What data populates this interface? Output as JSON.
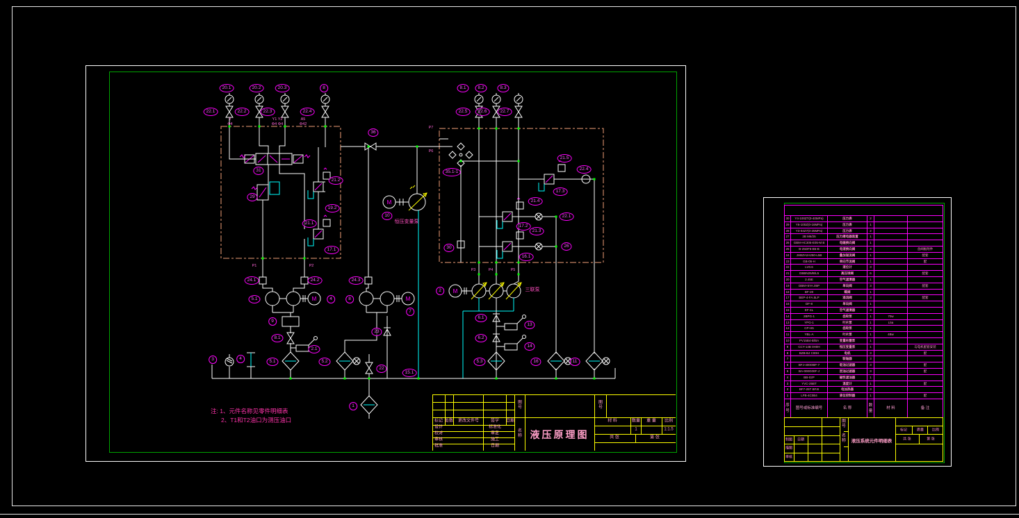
{
  "sheet1": {
    "notes": {
      "line1": "注: 1、元件名称见零件明细表",
      "line2": "2、T1和T2油口为测压油口"
    },
    "texts": {
      "motor_letter": "M",
      "variable_pump_label": "恒压变量泵",
      "triple_pump_label": "三联泵"
    },
    "labels": [
      "20.1",
      "20.2",
      "20.3",
      "8",
      "22.1",
      "22.2",
      "22.3",
      "22.4",
      "36",
      "8.1",
      "8.2",
      "8.3",
      "22.5",
      "22.6",
      "22.7",
      "31",
      "29",
      "21.2",
      "19.2",
      "21.1",
      "17.1",
      "35.1-1",
      "21.5",
      "22.4",
      "17.3",
      "21.4",
      "17.2",
      "22.1",
      "21.3",
      "16.1",
      "26",
      "30",
      "10",
      "24.1",
      "24.2",
      "24.3",
      "5.1",
      "4",
      "8",
      "7",
      "2",
      "9",
      "8.1",
      "3",
      "4",
      "5.1",
      "2.1",
      "5.2",
      "23",
      "1",
      "22",
      "15.1",
      "6.1",
      "6.2",
      "13",
      "14",
      "5.3",
      "16",
      "11"
    ],
    "ports": [
      "P1",
      "P2",
      "P3",
      "P4",
      "P5",
      "P6",
      "P7",
      "Y",
      "Φ4",
      "Y1 Y2",
      "Φ4 Φ4",
      "A5",
      "Φ42"
    ],
    "tb": {
      "rev_header": [
        "标记",
        "处数",
        "更改文件号",
        "签字",
        "日期"
      ],
      "sign_rows": [
        {
          "l": "设计",
          "r": "标准化"
        },
        {
          "l": "校对",
          "r": "审定"
        },
        {
          "l": "审核",
          "r": "施工"
        },
        {
          "l": "批准",
          "r": "日期"
        }
      ],
      "drawing_no_label": "图号",
      "drawing_no_label2": "图号",
      "name_label": "名称",
      "title": "液压原理图",
      "material_label": "材 料",
      "qty_label": "数量",
      "weight_label": "重 量",
      "scale_label": "比例",
      "qty_value": "1",
      "scale_value": "1:1.5",
      "sheets_label": "共  张",
      "sheet_no_label": "第  张"
    }
  },
  "sheet2": {
    "table": {
      "header": [
        "序号",
        "图号或标准编号",
        "名 称",
        "数量",
        "材 料",
        "备 注"
      ],
      "rows": [
        {
          "no": "30",
          "model": "Y4-100ZT(0-40MPa)",
          "name": "压力表",
          "qty": "2",
          "mat": "",
          "note": ""
        },
        {
          "no": "29",
          "model": "Y6-100Z(0-16MPa)",
          "name": "压力表",
          "qty": "1",
          "mat": "",
          "note": ""
        },
        {
          "no": "28",
          "model": "Y3-04Z7(0-25MPa)",
          "name": "压力表",
          "qty": "2",
          "mat": "",
          "note": ""
        },
        {
          "no": "27",
          "model": "2B M6/25",
          "name": "压力继电器装置",
          "qty": "1",
          "mat": "",
          "note": ""
        },
        {
          "no": "26",
          "model": "GBM-HC305-E05-M B",
          "name": "电磁换向阀",
          "qty": "1",
          "mat": "",
          "note": ""
        },
        {
          "no": "25",
          "model": "B-25DF5-B5-B",
          "name": "电液换向阀",
          "qty": "4",
          "mat": "",
          "note": "含阀板附件"
        },
        {
          "no": "24",
          "model": "JHBZA2A250-L5B",
          "name": "叠加溢流阀",
          "qty": "1",
          "mat": "",
          "note": "配套"
        },
        {
          "no": "23",
          "model": "GB-05-H",
          "name": "单向节流阀",
          "qty": "1",
          "mat": "",
          "note": "配"
        },
        {
          "no": "22",
          "model": "LV0.6",
          "name": "液位计",
          "qty": "3",
          "mat": "",
          "note": ""
        },
        {
          "no": "21",
          "model": "GBBN25/B/L5",
          "name": "高压球阀",
          "qty": "6",
          "mat": "",
          "note": "配套"
        },
        {
          "no": "20",
          "model": "2.45E",
          "name": "空气滤清器",
          "qty": "1",
          "mat": "",
          "note": ""
        },
        {
          "no": "19",
          "model": "DBM+5YA.05P",
          "name": "单向阀",
          "qty": "3",
          "mat": "",
          "note": "配套"
        },
        {
          "no": "18",
          "model": "BF-20",
          "name": "蝶阀",
          "qty": "1",
          "mat": "",
          "note": ""
        },
        {
          "no": "17",
          "model": "BEP-4-FA.5LP",
          "name": "溢流阀",
          "qty": "3",
          "mat": "",
          "note": "配套"
        },
        {
          "no": "16",
          "model": "DF-8",
          "name": "单向阀",
          "qty": "1",
          "mat": "",
          "note": ""
        },
        {
          "no": "15",
          "model": "EF-4L",
          "name": "空气滤清器",
          "qty": "3",
          "mat": "",
          "note": ""
        },
        {
          "no": "14",
          "model": "2BPG-1",
          "name": "齿轮泵",
          "qty": "1",
          "mat": "70w",
          "note": ""
        },
        {
          "no": "13",
          "model": "YPG-1",
          "name": "叶片泵",
          "qty": "1",
          "mat": "L5a",
          "note": ""
        },
        {
          "no": "12",
          "model": "CP-H5",
          "name": "齿轮泵",
          "qty": "1",
          "mat": "",
          "note": ""
        },
        {
          "no": "11",
          "model": "YBL-A",
          "name": "叶片泵",
          "qty": "1",
          "mat": "4Bw",
          "note": ""
        },
        {
          "no": "10",
          "model": "PV15B4-B/BA",
          "name": "变量柱塞泵",
          "qty": "1",
          "mat": "",
          "note": ""
        },
        {
          "no": "9",
          "model": "CCY-14B 0H0H",
          "name": "恒压变量泵",
          "qty": "1",
          "mat": "",
          "note": "与电机配套安装"
        },
        {
          "no": "8",
          "model": "BZB-BJ C00H",
          "name": "电机",
          "qty": "3",
          "mat": "",
          "note": "配"
        },
        {
          "no": "7",
          "model": "",
          "name": "联轴器",
          "qty": "3",
          "mat": "",
          "note": ""
        },
        {
          "no": "6",
          "model": "BFJ-400OBF-7",
          "name": "吸油过滤器",
          "qty": "3",
          "mat": "",
          "note": "配"
        },
        {
          "no": "5",
          "model": "BA-000G00F-J",
          "name": "回油过滤器",
          "qty": "3",
          "mat": "",
          "note": "配"
        },
        {
          "no": "4",
          "model": "BB-02P",
          "name": "磁性滤油器",
          "qty": "1",
          "mat": "",
          "note": ""
        },
        {
          "no": "3",
          "model": "YVC-25BT",
          "name": "温度计",
          "qty": "1",
          "mat": "",
          "note": "配"
        },
        {
          "no": "2",
          "model": "BF7-25T BF.B",
          "name": "电加热器",
          "qty": "3",
          "mat": "",
          "note": ""
        },
        {
          "no": "1",
          "model": "LFB-4C0B4",
          "name": "液位控制器",
          "qty": "1",
          "mat": "",
          "note": "配"
        }
      ]
    },
    "tb": {
      "title": "液压系统元件明细表",
      "mini": [
        "制图",
        "描图",
        "审核",
        "日期"
      ],
      "cells": [
        "图号",
        "名称",
        "标记",
        "质量",
        "比例",
        "共 张",
        "第 张"
      ]
    }
  }
}
